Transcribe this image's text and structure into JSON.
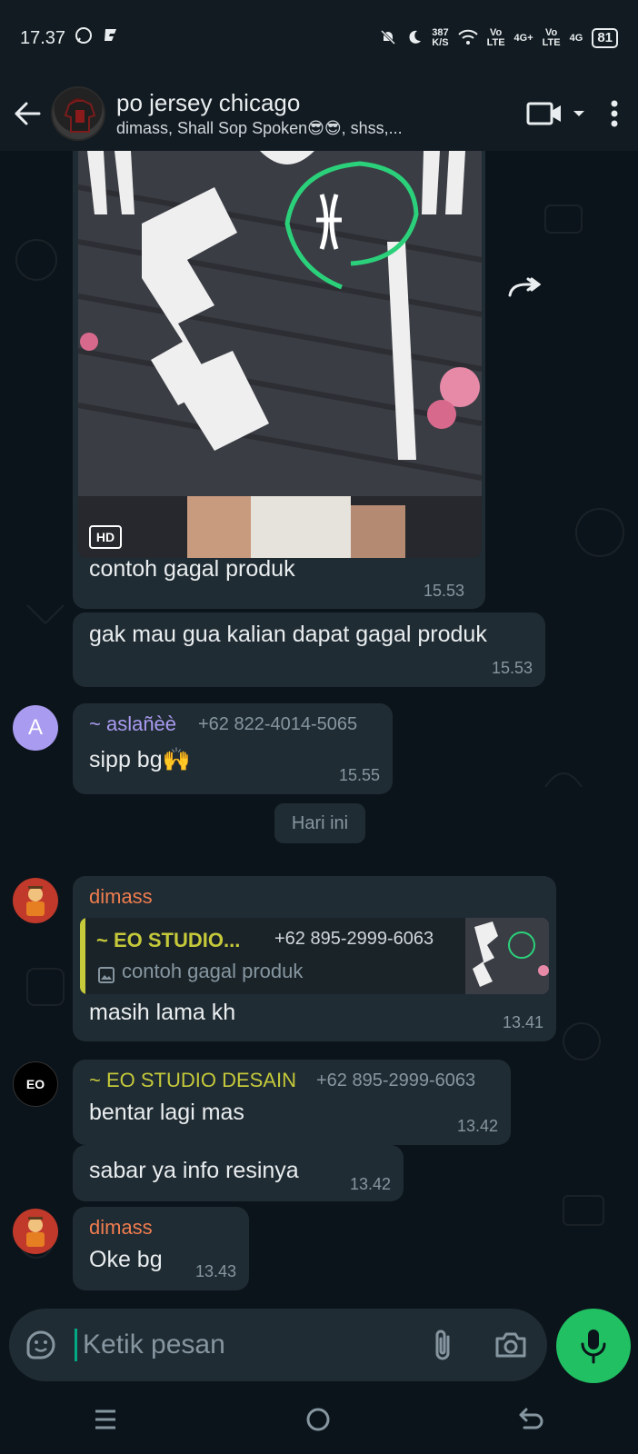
{
  "status_bar": {
    "time": "17.37",
    "net_speed_top": "387",
    "net_speed_unit": "K/S",
    "sim1": "Vo\nLTE",
    "sim1_net": "4G+",
    "sim2": "Vo\nLTE",
    "sim2_net": "4G",
    "battery": "81"
  },
  "header": {
    "title": "po jersey chicago",
    "subtitle": "dimass, Shall Sop Spoken😎😎, shss,..."
  },
  "messages": {
    "m1_caption": "contoh gagal produk",
    "m1_time": "15.53",
    "m1_hd": "HD",
    "m2_text": "gak mau gua kalian dapat gagal produk",
    "m2_time": "15.53",
    "m3_avatar_letter": "A",
    "m3_sender": "~ aslañèè",
    "m3_phone": "+62 822-4014-5065",
    "m3_text": "sipp bg🙌",
    "m3_time": "15.55",
    "date_chip": "Hari ini",
    "m4_sender": "dimass",
    "m4_quote_sender": "~ EO STUDIO...",
    "m4_quote_phone": "+62 895-2999-6063",
    "m4_quote_text": "contoh gagal produk",
    "m4_text": "masih lama kh",
    "m4_time": "13.41",
    "m5_avatar_text": "EO",
    "m5_sender": "~ EO STUDIO DESAIN",
    "m5_phone": "+62 895-2999-6063",
    "m5_text": "bentar lagi mas",
    "m5_time": "13.42",
    "m6_text": "sabar ya info resinya",
    "m6_time": "13.42",
    "m7_sender": "dimass",
    "m7_text": "Oke bg",
    "m7_time": "13.43"
  },
  "input": {
    "placeholder": "Ketik pesan"
  },
  "colors": {
    "background": "#0b141a",
    "bubble": "#202c33",
    "accent_green": "#21c063",
    "sender_orange": "#f07d4f",
    "sender_purple": "#a99bf0",
    "sender_olive": "#c5c93a"
  }
}
